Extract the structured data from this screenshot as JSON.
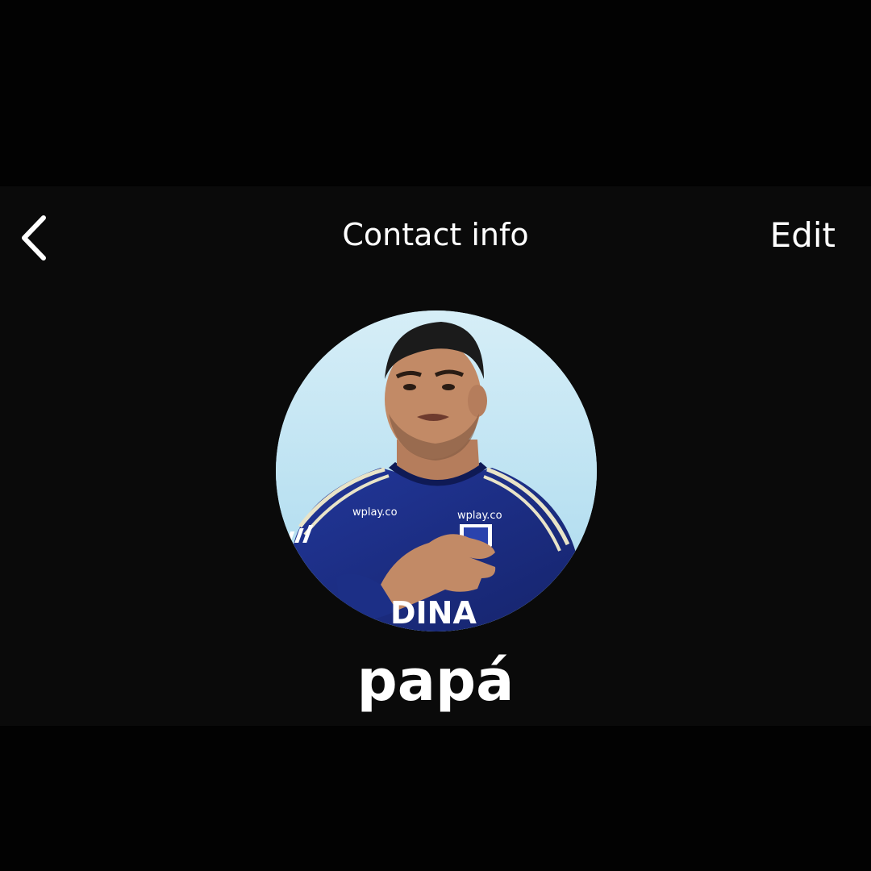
{
  "header": {
    "title": "Contact info",
    "edit_label": "Edit",
    "back_icon": "chevron-left-icon"
  },
  "contact": {
    "name": "papá",
    "photo": {
      "description_icon": "profile-photo",
      "jersey_sponsor": "wplay.co",
      "jersey_lettering": "DINA"
    }
  },
  "colors": {
    "background": "#020202",
    "panel": "#0a0a0a",
    "text": "#ffffff",
    "jersey": "#1c2f86"
  }
}
